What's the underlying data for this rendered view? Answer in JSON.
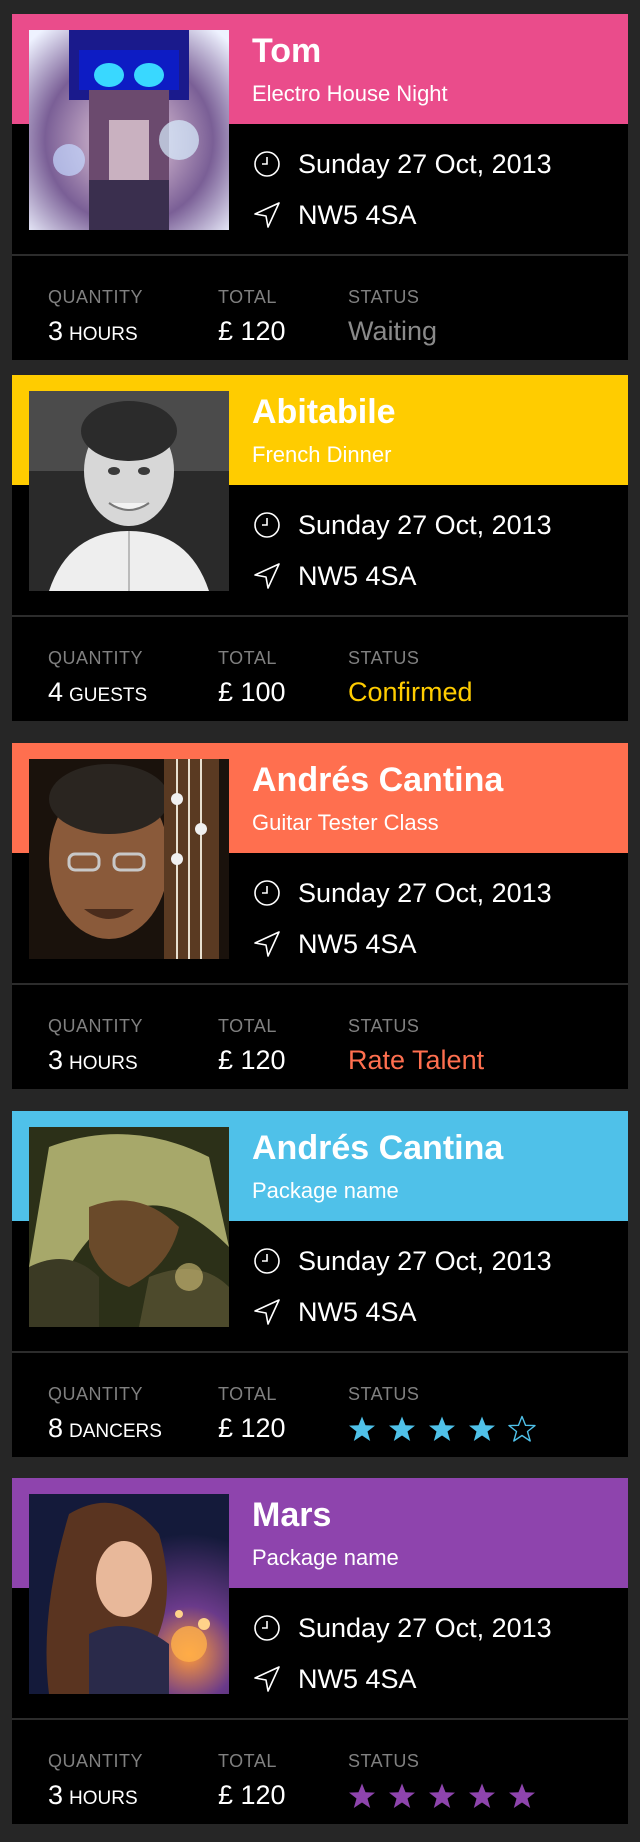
{
  "labels": {
    "quantity": "QUANTITY",
    "total": "TOTAL",
    "status": "STATUS"
  },
  "bookings": [
    {
      "name": "Tom",
      "event": "Electro House Night",
      "date": "Sunday 27 Oct, 2013",
      "location": "NW5 4SA",
      "quantity": "3",
      "unit": "HOURS",
      "total": "£ 120",
      "status": "Waiting",
      "status_color": "#8a8a8a",
      "accent": "#ea4c8b",
      "rating": null
    },
    {
      "name": "Abitabile",
      "event": "French Dinner",
      "date": "Sunday 27 Oct, 2013",
      "location": "NW5 4SA",
      "quantity": "4",
      "unit": "GUESTS",
      "total": "£ 100",
      "status": "Confirmed",
      "status_color": "#ffcc00",
      "accent": "#ffcc00",
      "rating": null
    },
    {
      "name": "Andrés Cantina",
      "event": "Guitar Tester Class",
      "date": "Sunday 27 Oct, 2013",
      "location": "NW5 4SA",
      "quantity": "3",
      "unit": "HOURS",
      "total": "£ 120",
      "status": "Rate Talent",
      "status_color": "#ff6f4f",
      "accent": "#ff6f4f",
      "rating": null
    },
    {
      "name": "Andrés Cantina",
      "event": "Package name",
      "date": "Sunday 27 Oct, 2013",
      "location": "NW5 4SA",
      "quantity": "8",
      "unit": "DANCERS",
      "total": "£ 120",
      "status": "",
      "status_color": "#4fc1e9",
      "accent": "#4fc1e9",
      "rating": {
        "filled": 4,
        "max": 5
      }
    },
    {
      "name": "Mars",
      "event": "Package name",
      "date": "Sunday 27 Oct, 2013",
      "location": "NW5 4SA",
      "quantity": "3",
      "unit": "HOURS",
      "total": "£ 120",
      "status": "",
      "status_color": "#8e44ad",
      "accent": "#8e44ad",
      "rating": {
        "filled": 5,
        "max": 5
      }
    }
  ],
  "icons": {
    "date": "clock-icon",
    "location": "location-arrow-icon",
    "rating": "star-icon"
  }
}
